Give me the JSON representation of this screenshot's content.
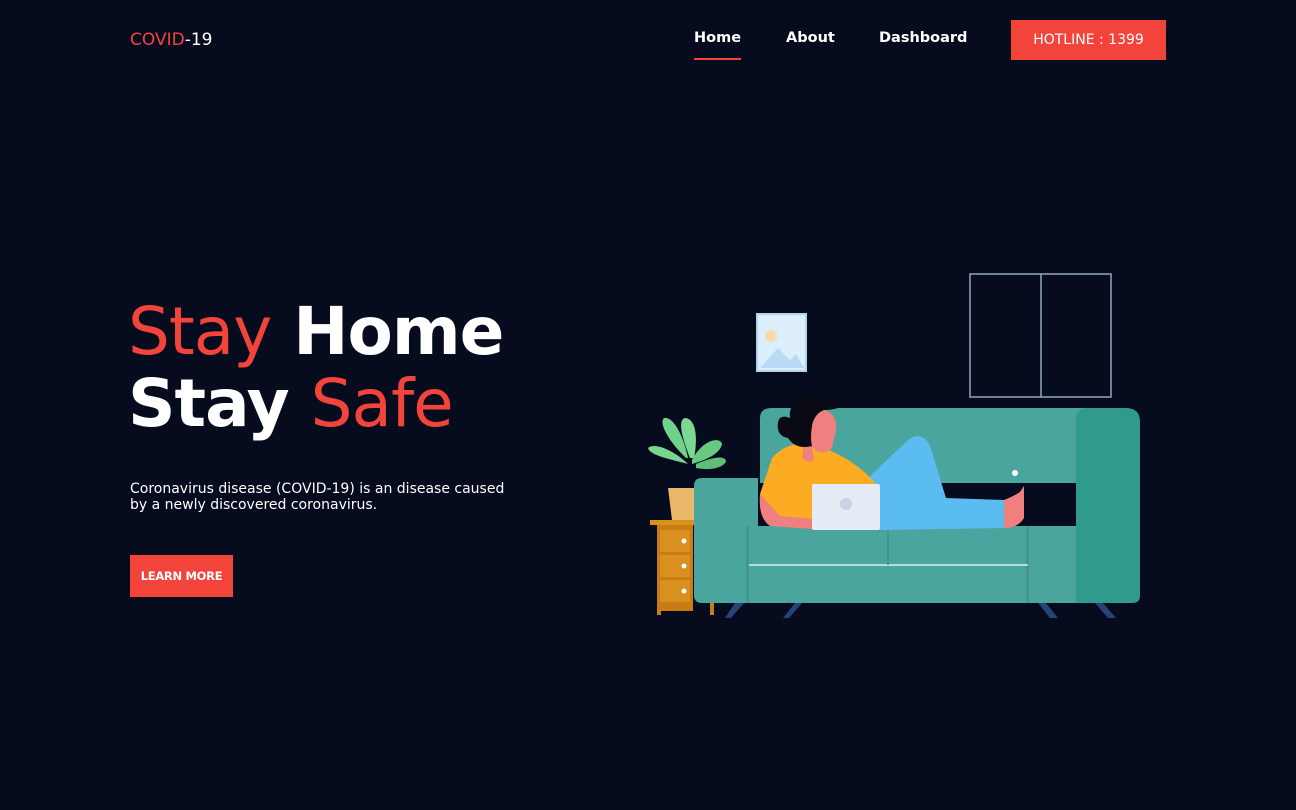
{
  "header": {
    "logo_part1": "COVID",
    "logo_part2": "-19",
    "nav": [
      {
        "label": "Home"
      },
      {
        "label": "About"
      },
      {
        "label": "Dashboard"
      }
    ],
    "hotline_label": "HOTLINE : 1399"
  },
  "hero": {
    "line1_word1": "Stay",
    "line1_word2": "Home",
    "line2_word1": "Stay",
    "line2_word2": "Safe",
    "description": "Coronavirus disease (COVID-19) is an disease caused by a newly discovered coronavirus.",
    "cta_label": "LEARN MORE"
  },
  "colors": {
    "background": "#060b1e",
    "accent": "#f2443b",
    "text": "#ffffff",
    "sofa": "#4aa59e",
    "shirt": "#fbac23",
    "pants": "#5bbcf2"
  },
  "icons": {
    "illustration": "woman-on-sofa-with-laptop"
  }
}
